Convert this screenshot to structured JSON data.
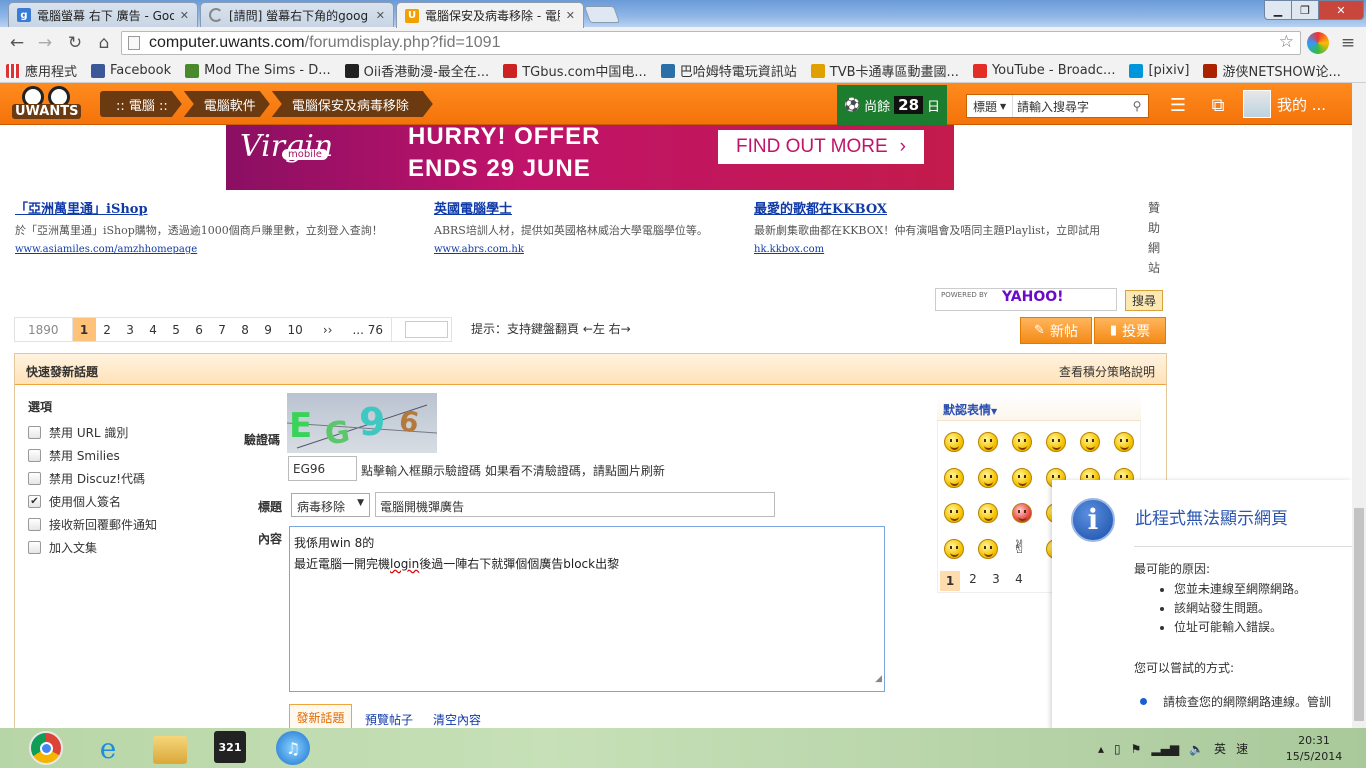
{
  "browser": {
    "tabs": [
      {
        "title": "電腦螢幕 右下 廣告 - Goo",
        "favicon": "google-icon"
      },
      {
        "title": "[請問] 螢幕右下角的goog",
        "favicon": "loading-icon"
      },
      {
        "title": "電腦保安及病毒移除 - 電腦",
        "favicon": "uwants-icon"
      }
    ],
    "url_host": "computer.uwants.com",
    "url_path": "/forumdisplay.php?fid=1091",
    "bookmarks": [
      {
        "label": "應用程式",
        "color": "#3a7bd5"
      },
      {
        "label": "Facebook",
        "color": "#3b5998"
      },
      {
        "label": "Mod The Sims - D...",
        "color": "#4a8a2a"
      },
      {
        "label": "Oii香港動漫-最全在...",
        "color": "#222222"
      },
      {
        "label": "TGbus.com中国电...",
        "color": "#cc2222"
      },
      {
        "label": "巴哈姆特電玩資訊站",
        "color": "#2a6fa8"
      },
      {
        "label": "TVB卡通專區動畫國...",
        "color": "#e0a000"
      },
      {
        "label": "YouTube - Broadc...",
        "color": "#e52d27"
      },
      {
        "label": "[pixiv]",
        "color": "#0096db"
      },
      {
        "label": "游侠NETSHOW论...",
        "color": "#aa2200"
      }
    ]
  },
  "site": {
    "logo": "UWANTS",
    "breadcrumbs": [
      ":: 電腦 ::",
      "電腦軟件",
      "電腦保安及病毒移除"
    ],
    "days_left_label": "尚餘",
    "days_left_value": "28",
    "days_left_unit": "日",
    "search_scope": "標題",
    "search_placeholder": "請輸入搜尋字",
    "mine_label": "我的 ..."
  },
  "banner": {
    "brand": "Virgin",
    "brand_sub": "mobile",
    "headline1": "HURRY! OFFER",
    "headline2": "ENDS 29 JUNE",
    "cta": "FIND OUT MORE"
  },
  "text_ads": [
    {
      "title": "「亞洲萬里通」iShop",
      "desc": "於「亞洲萬里通」iShop購物，透過逾1000個商戶賺里數，立刻登入查詢！",
      "url": "www.asiamiles.com/amzhhomepage"
    },
    {
      "title": "英國電腦學士",
      "desc": "ABRS培訓人材，提供如英國格林威治大學電腦學位等。",
      "url": "www.abrs.com.hk"
    },
    {
      "title": "最愛的歌都在KKBOX",
      "desc": "最新劇集歌曲都在KKBOX！仲有演唱會及唔同主題Playlist，立即試用",
      "url": "hk.kkbox.com"
    }
  ],
  "sponsor_label": "贊助網站",
  "yahoo": {
    "powered": "POWERED BY",
    "brand": "YAHOO!",
    "button": "搜尋"
  },
  "pager": {
    "total": "1890",
    "current": "1",
    "pages": [
      "2",
      "3",
      "4",
      "5",
      "6",
      "7",
      "8",
      "9",
      "10"
    ],
    "next": "››",
    "last": "... 76",
    "hint": "提示：支持鍵盤翻頁 ←左 右→"
  },
  "actions": {
    "new_thread": "新帖",
    "poll": "投票"
  },
  "quick_post": {
    "title": "快速發新話題",
    "help_link": "查看積分策略說明",
    "options_heading": "選項",
    "options": [
      {
        "label": "禁用 URL 識別",
        "checked": false
      },
      {
        "label": "禁用 Smilies",
        "checked": false
      },
      {
        "label": "禁用 Discuz!代碼",
        "checked": false
      },
      {
        "label": "使用個人簽名",
        "checked": true
      },
      {
        "label": "接收新回覆郵件通知",
        "checked": false
      },
      {
        "label": "加入文集",
        "checked": false
      }
    ],
    "captcha_label": "驗證碼",
    "captcha_text": "EG96",
    "captcha_tip": "點擊輸入框顯示驗證碼 如果看不清驗證碼，請點圖片刷新",
    "subject_label": "標題",
    "type_value": "病毒移除",
    "subject_value": "電腦開機彈廣告",
    "content_label": "內容",
    "content_line1": "我係用win 8的",
    "content_line2_a": "最近電腦一開完機",
    "content_line2_b": "login",
    "content_line2_c": "後過一陣右下就彈個個廣告block出黎",
    "submit": "發新話題",
    "preview": "預覽帖子",
    "clear": "清空內容"
  },
  "smilies": {
    "heading": "默認表情",
    "pages": [
      "1",
      "2",
      "3",
      "4"
    ]
  },
  "notification": {
    "title": "此程式無法顯示網頁",
    "causes_heading": "最可能的原因:",
    "causes": [
      "您並未連線至網際網路。",
      "該網站發生問題。",
      "位址可能輸入錯誤。"
    ],
    "fix_heading": "您可以嘗試的方式:",
    "fix_item": "請檢查您的網際網路連線。管訓"
  },
  "taskbar": {
    "ime1": "英",
    "ime2": "速",
    "time": "20:31",
    "date": "15/5/2014"
  }
}
